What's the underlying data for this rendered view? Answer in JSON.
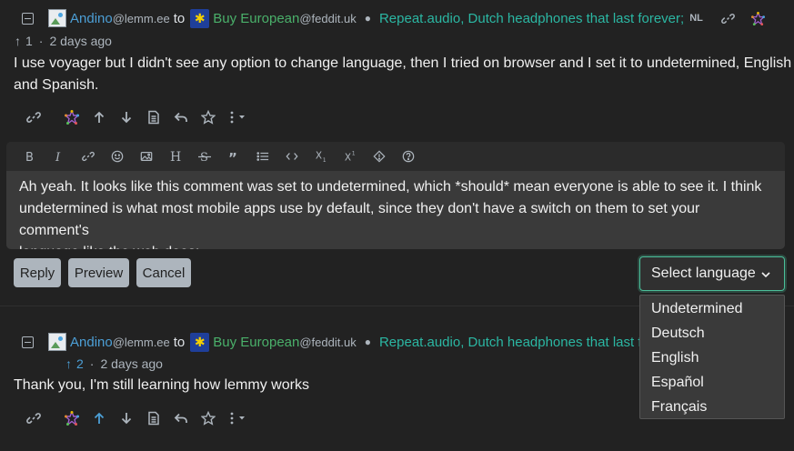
{
  "comment1": {
    "user": "Andino",
    "user_instance": "@lemm.ee",
    "to_word": "to",
    "community": "Buy European",
    "community_instance": "@feddit.uk",
    "post_title": "Repeat.audio, Dutch headphones that last forever;",
    "lang_badge": "NL",
    "score_arrow": "↑",
    "score": "1",
    "separator": "·",
    "time": "2 days ago",
    "body_line1": "I use voyager but I didn't see any option to change language, then I tried on browser and I set it to undetermined, English",
    "body_line2": "and Spanish."
  },
  "editor": {
    "toolbar": [
      "bold-icon",
      "italic-icon",
      "link-icon",
      "emoji-icon",
      "image-icon",
      "header-icon",
      "strikethrough-icon",
      "quote-icon",
      "list-icon",
      "code-icon",
      "subscript-icon",
      "superscript-icon",
      "spoiler-icon",
      "help-icon"
    ],
    "text_line1": "Ah yeah. It looks like this comment was set to undetermined, which *should* mean everyone is able to see it. I think",
    "text_line2": "undetermined is what most mobile apps use by default, since they don't have a switch on them to set your comment's",
    "text_line3": "language like the web does:"
  },
  "buttons": {
    "reply": "Reply",
    "preview": "Preview",
    "cancel": "Cancel"
  },
  "language_select": {
    "label": "Select language",
    "options": [
      "Undetermined",
      "Deutsch",
      "English",
      "Español",
      "Français"
    ]
  },
  "comment2": {
    "user": "Andino",
    "user_instance": "@lemm.ee",
    "to_word": "to",
    "community": "Buy European",
    "community_instance": "@feddit.uk",
    "post_title": "Repeat.audio, Dutch headphones that last forever;",
    "score_arrow": "↑",
    "score": "2",
    "separator": "·",
    "time": "2 days ago",
    "body": "Thank you, I'm still learning how lemmy works"
  },
  "colors": {
    "background": "#222222",
    "user_link": "#4c9fd6",
    "community_link": "#4ab06a",
    "post_link": "#2bb7a3",
    "focus_border": "#4bbf9a"
  }
}
